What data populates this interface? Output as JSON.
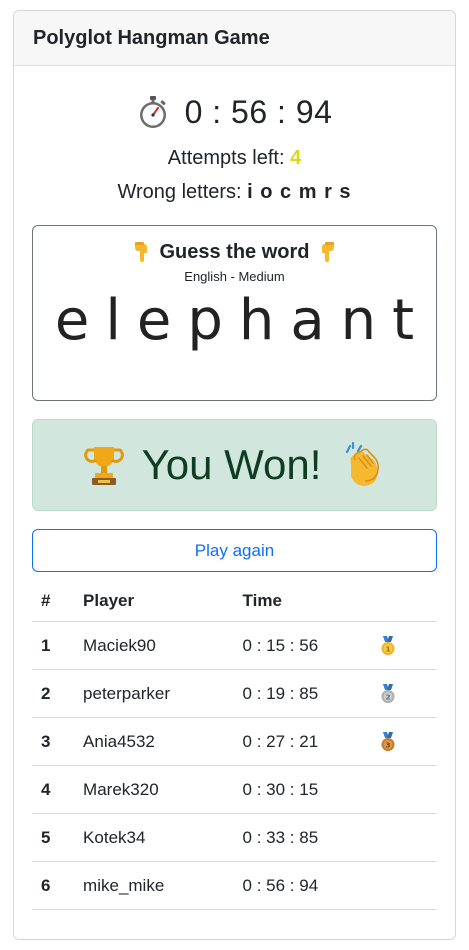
{
  "header": {
    "title": "Polyglot Hangman Game"
  },
  "timer": {
    "icon": "stopwatch-icon",
    "value": "0 : 56 : 94"
  },
  "status": {
    "attempts_label": "Attempts left: ",
    "attempts_value": "4",
    "wrong_label": "Wrong letters: ",
    "wrong_value": "i o c m r s"
  },
  "word_panel": {
    "heading": "Guess the word",
    "subtitle": "English - Medium",
    "word": "elephant",
    "icon": "pointing-down-hand-icon"
  },
  "result": {
    "message": "You Won!",
    "icons": [
      "trophy-icon",
      "clapping-hands-icon"
    ]
  },
  "actions": {
    "play_again_label": "Play again"
  },
  "leaderboard": {
    "columns": [
      "#",
      "Player",
      "Time",
      ""
    ],
    "rows": [
      {
        "rank": "1",
        "player": "Maciek90",
        "time": "0 : 15 : 56",
        "medal": "gold"
      },
      {
        "rank": "2",
        "player": "peterparker",
        "time": "0 : 19 : 85",
        "medal": "silver"
      },
      {
        "rank": "3",
        "player": "Ania4532",
        "time": "0 : 27 : 21",
        "medal": "bronze"
      },
      {
        "rank": "4",
        "player": "Marek320",
        "time": "0 : 30 : 15",
        "medal": ""
      },
      {
        "rank": "5",
        "player": "Kotek34",
        "time": "0 : 33 : 85",
        "medal": ""
      },
      {
        "rank": "6",
        "player": "mike_mike",
        "time": "0 : 56 : 94",
        "medal": ""
      }
    ]
  },
  "colors": {
    "accent": "#0d6efd",
    "attempts": "#d9d919",
    "success_bg": "#d1e7dd",
    "success_text": "#0f3d24",
    "gold": "#f0b323",
    "silver": "#b8bcc2",
    "bronze": "#cd7f32"
  }
}
